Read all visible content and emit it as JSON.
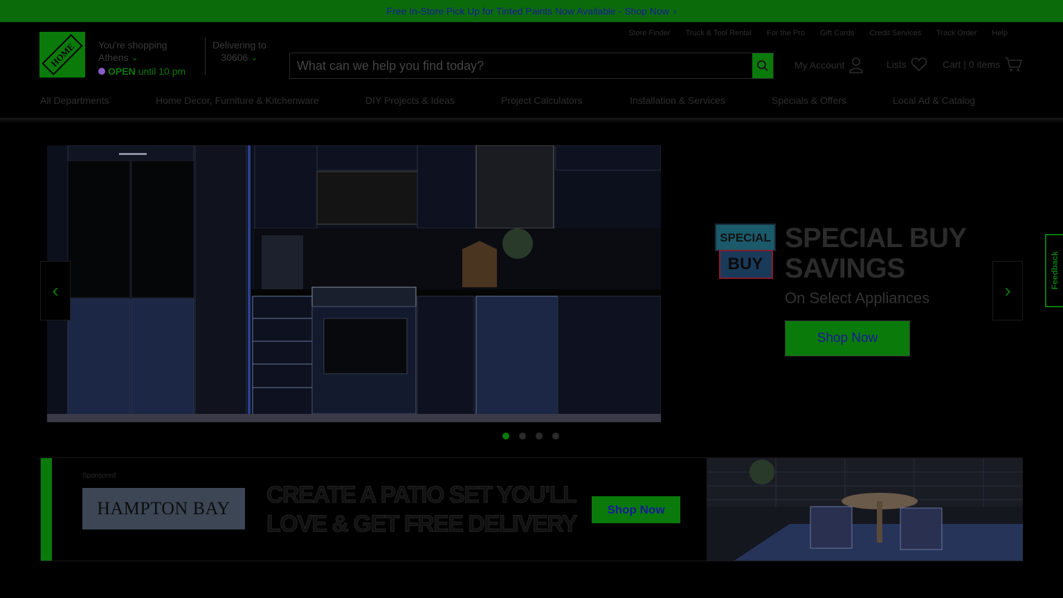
{
  "promo": {
    "text": "Free In-Store Pick Up for Tinted Paints Now Available - Shop Now",
    "chevron_icon": "chevron-right-icon"
  },
  "header": {
    "logo_alt": "The Home Depot",
    "store": {
      "label": "You're shopping",
      "city": "Athens",
      "status": "OPEN",
      "hours": "until 10 pm"
    },
    "delivery": {
      "label": "Delivering to",
      "zip": "30606"
    },
    "top_links": [
      "Store Finder",
      "Truck & Tool Rental",
      "For the Pro",
      "Gift Cards",
      "Credit Services",
      "Track Order",
      "Help"
    ],
    "search": {
      "placeholder": "What can we help you find today?"
    },
    "account_label": "My Account",
    "lists_label": "Lists",
    "cart_label": "Cart | 0 items"
  },
  "nav": {
    "items": [
      "All Departments",
      "Home Decor, Furniture & Kitchenware",
      "DIY Projects & Ideas",
      "Project Calculators",
      "Installation & Services",
      "Specials & Offers",
      "Local Ad & Catalog"
    ]
  },
  "hero": {
    "badge_line1": "SPECIAL",
    "badge_line2": "BUY",
    "title": "SPECIAL BUY SAVINGS",
    "subtitle": "On Select Appliances",
    "button": "Shop Now",
    "slide_count": 4,
    "active_slide": 1
  },
  "sponsored": {
    "label": "Sponsored",
    "brand": "HAMPTON BAY",
    "headline_line1": "CREATE A PATIO SET YOU'LL",
    "headline_line2": "LOVE & GET FREE DELIVERY",
    "button": "Shop Now"
  },
  "feedback": {
    "label": "Feedback"
  },
  "colors": {
    "accent": "#0a7a0a",
    "link": "#1a1a9a",
    "background": "#000000"
  }
}
